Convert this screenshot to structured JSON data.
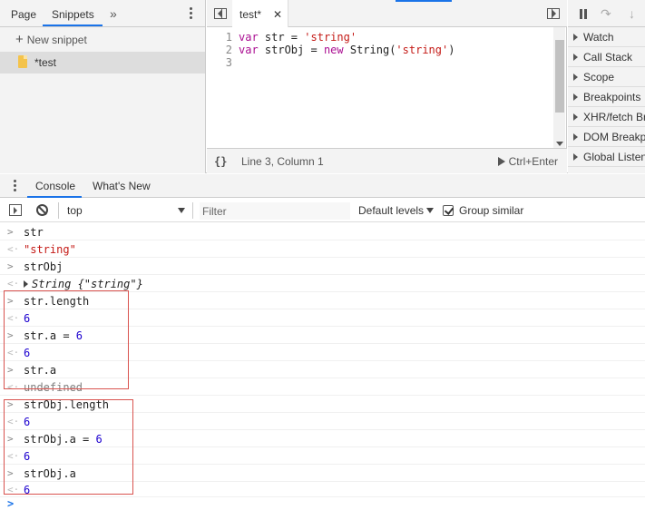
{
  "navigator": {
    "tabs": [
      {
        "label": "Page",
        "active": false
      },
      {
        "label": "Snippets",
        "active": true
      }
    ],
    "more_tabs_glyph": "»",
    "new_snippet_label": "New snippet",
    "snippets": [
      {
        "label": "*test"
      }
    ]
  },
  "editor": {
    "file_tab": {
      "label": "test*",
      "close_glyph": "✕"
    },
    "lines": [
      {
        "num": "1"
      },
      {
        "num": "2"
      },
      {
        "num": "3"
      }
    ],
    "code": {
      "line1": {
        "kw": "var",
        "name": " str = ",
        "str": "'string'"
      },
      "line2": {
        "kw": "var",
        "name": " strObj = ",
        "kw2": "new",
        "call": " String(",
        "str": "'string'",
        "close": ")"
      }
    },
    "status": {
      "pretty_print": "{}",
      "cursor": "Line 3, Column 1",
      "run_label": "Ctrl+Enter"
    }
  },
  "debugger": {
    "sections": [
      {
        "label": "Watch"
      },
      {
        "label": "Call Stack"
      },
      {
        "label": "Scope"
      },
      {
        "label": "Breakpoints"
      },
      {
        "label": "XHR/fetch Breakpoints"
      },
      {
        "label": "DOM Breakpoints"
      },
      {
        "label": "Global Listeners"
      }
    ]
  },
  "drawer": {
    "tabs": [
      {
        "label": "Console",
        "active": true
      },
      {
        "label": "What's New",
        "active": false
      }
    ]
  },
  "console_toolbar": {
    "context": "top",
    "filter_placeholder": "Filter",
    "levels_label": "Default levels",
    "group_similar_label": "Group similar",
    "group_similar_checked": true
  },
  "console": {
    "prompt_glyph": ">",
    "result_glyph": "<·",
    "messages": [
      {
        "type": "input",
        "text": "str"
      },
      {
        "type": "result",
        "text": "\"string\"",
        "kind": "string"
      },
      {
        "type": "input",
        "text": "strObj"
      },
      {
        "type": "result",
        "text": "String {\"string\"}",
        "kind": "object"
      },
      {
        "type": "input",
        "text": "str.length"
      },
      {
        "type": "result",
        "text": "6",
        "kind": "number"
      },
      {
        "type": "input",
        "text": "str.a = ",
        "num": "6"
      },
      {
        "type": "result",
        "text": "6",
        "kind": "number"
      },
      {
        "type": "input",
        "text": "str.a"
      },
      {
        "type": "result",
        "text": "undefined",
        "kind": "undefined"
      },
      {
        "type": "input",
        "text": "strObj.length"
      },
      {
        "type": "result",
        "text": "6",
        "kind": "number"
      },
      {
        "type": "input",
        "text": "strObj.a = ",
        "num": "6"
      },
      {
        "type": "result",
        "text": "6",
        "kind": "number"
      },
      {
        "type": "input",
        "text": "strObj.a"
      },
      {
        "type": "result",
        "text": "6",
        "kind": "number"
      }
    ]
  },
  "colors": {
    "accent": "#1a73e8",
    "string": "#c41a16",
    "number": "#1c00cf",
    "keyword": "#aa0d91",
    "highlight_box": "#d9534f"
  }
}
